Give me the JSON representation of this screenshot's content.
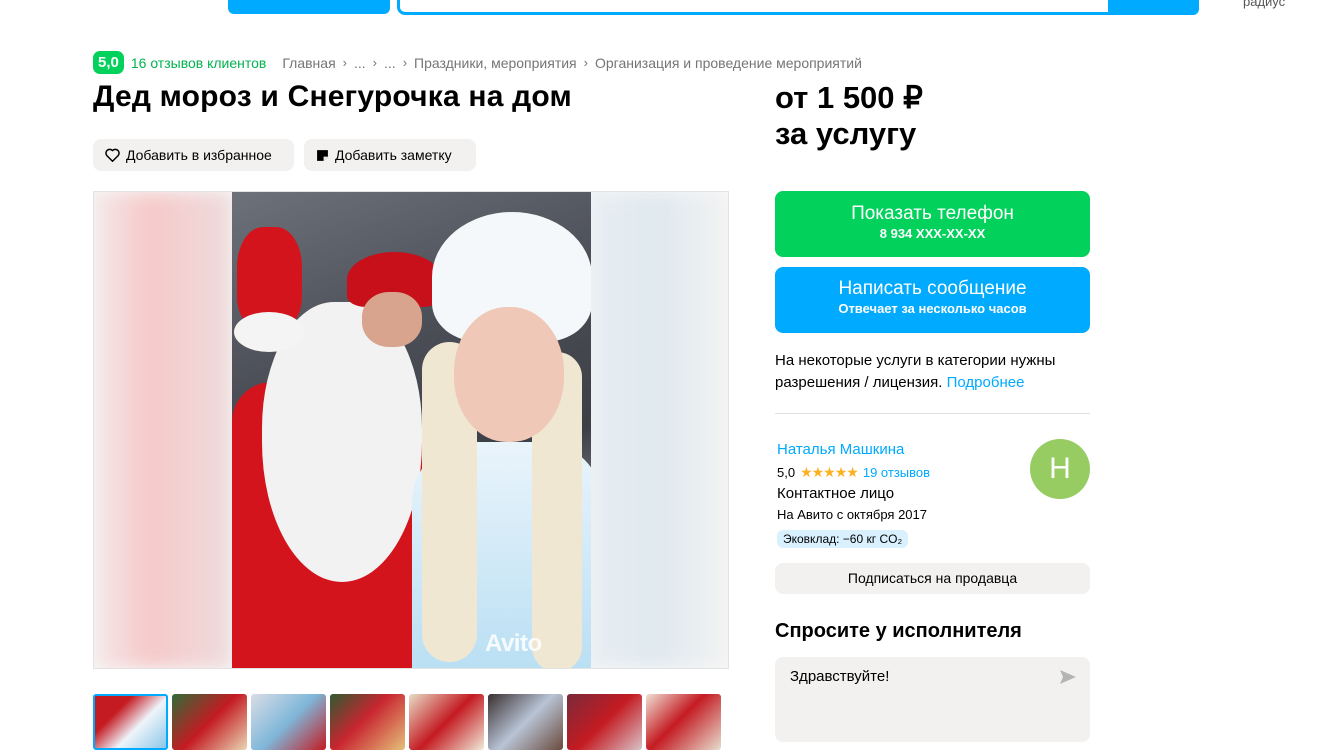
{
  "header": {
    "radius_text": "радиус"
  },
  "rating": {
    "score": "5,0",
    "reviews": "16 отзывов клиентов"
  },
  "breadcrumbs": [
    "Главная",
    "...",
    "...",
    "Праздники, мероприятия",
    "Организация и проведение мероприятий"
  ],
  "title": "Дед мороз и Снегурочка на дом",
  "actions": {
    "favorite": "Добавить в избранное",
    "note": "Добавить заметку"
  },
  "gallery": {
    "watermark": "Avito",
    "thumb_count": 8
  },
  "price": {
    "line1": "от 1 500 ₽",
    "line2": "за услугу"
  },
  "phone_button": {
    "label": "Показать телефон",
    "number": "8 934 XXX-XX-XX"
  },
  "message_button": {
    "label": "Написать сообщение",
    "sub": "Отвечает за несколько часов"
  },
  "license": {
    "text": "На некоторые услуги в категории нужны разрешения / лицензия.",
    "link": "Подробнее"
  },
  "seller": {
    "name": "Наталья Машкина",
    "rating": "5,0",
    "stars": "★★★★★",
    "reviews": "19 отзывов",
    "role": "Контактное лицо",
    "since": "На Авито с октября 2017",
    "eco": "Эковклад: −60 кг CO₂",
    "avatar_letter": "Н"
  },
  "subscribe": "Подписаться на продавца",
  "ask": {
    "title": "Спросите у исполнителя",
    "message": "Здравствуйте!"
  },
  "colors": {
    "green": "#02d15c",
    "blue": "#00aaff",
    "avatar": "#97cc63",
    "star": "#ffb021"
  }
}
